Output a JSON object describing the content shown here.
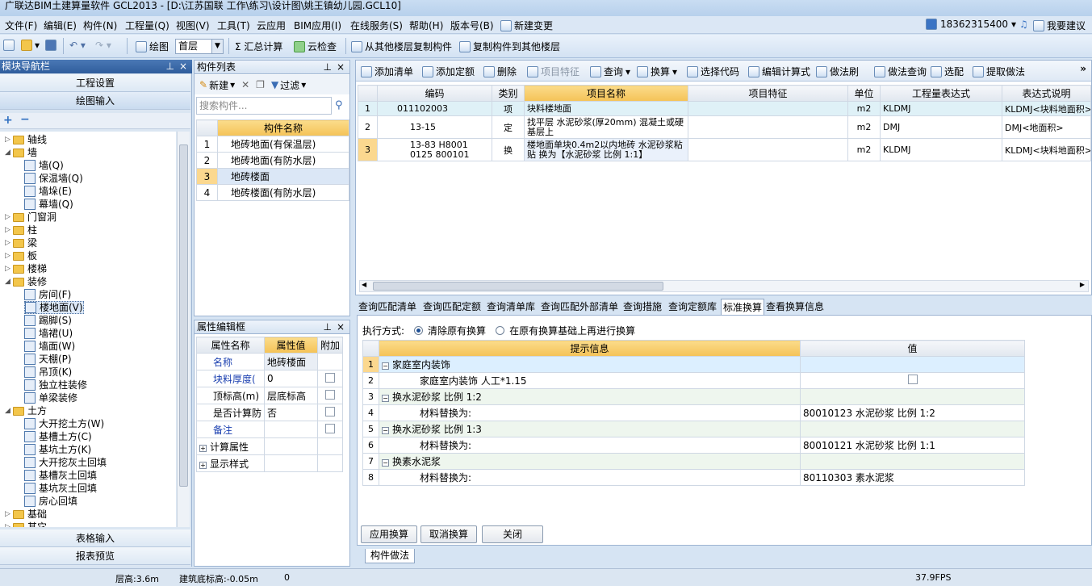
{
  "title": "广联达BIM土建算量软件 GCL2013 - [D:\\江苏国联 工作\\练习\\设计图\\姚王镇幼儿园.GCL10]",
  "menu": [
    "文件(F)",
    "编辑(E)",
    "构件(N)",
    "工程量(Q)",
    "视图(V)",
    "工具(T)",
    "云应用",
    "BIM应用(I)",
    "在线服务(S)",
    "帮助(H)",
    "版本号(B)",
    "新建变更"
  ],
  "account": "18362315400",
  "suggest": "我要建议",
  "toolbar": {
    "draw": "绘图",
    "floor": "首层",
    "sum": "Σ 汇总计算",
    "cloudcheck": "云检查",
    "copy_from": "从其他楼层复制构件",
    "copy_to": "复制构件到其他楼层"
  },
  "nav": {
    "title": "模块导航栏",
    "project_settings": "工程设置",
    "draw_input": "绘图输入",
    "table_input": "表格输入",
    "report_preview": "报表预览",
    "tree": [
      {
        "label": "轴线",
        "level": 0,
        "arrow": "▷"
      },
      {
        "label": "墙",
        "level": 0,
        "arrow": "◢"
      },
      {
        "label": "墙(Q)",
        "level": 1
      },
      {
        "label": "保温墙(Q)",
        "level": 1
      },
      {
        "label": "墙垛(E)",
        "level": 1
      },
      {
        "label": "幕墙(Q)",
        "level": 1
      },
      {
        "label": "门窗洞",
        "level": 0,
        "arrow": "▷"
      },
      {
        "label": "柱",
        "level": 0,
        "arrow": "▷"
      },
      {
        "label": "梁",
        "level": 0,
        "arrow": "▷"
      },
      {
        "label": "板",
        "level": 0,
        "arrow": "▷"
      },
      {
        "label": "楼梯",
        "level": 0,
        "arrow": "▷"
      },
      {
        "label": "装修",
        "level": 0,
        "arrow": "◢"
      },
      {
        "label": "房间(F)",
        "level": 1
      },
      {
        "label": "楼地面(V)",
        "level": 1,
        "selected": true
      },
      {
        "label": "踢脚(S)",
        "level": 1
      },
      {
        "label": "墙裙(U)",
        "level": 1
      },
      {
        "label": "墙面(W)",
        "level": 1
      },
      {
        "label": "天棚(P)",
        "level": 1
      },
      {
        "label": "吊顶(K)",
        "level": 1
      },
      {
        "label": "独立柱装修",
        "level": 1
      },
      {
        "label": "单梁装修",
        "level": 1
      },
      {
        "label": "土方",
        "level": 0,
        "arrow": "◢"
      },
      {
        "label": "大开挖土方(W)",
        "level": 1
      },
      {
        "label": "基槽土方(C)",
        "level": 1
      },
      {
        "label": "基坑土方(K)",
        "level": 1
      },
      {
        "label": "大开挖灰土回填",
        "level": 1
      },
      {
        "label": "基槽灰土回填",
        "level": 1
      },
      {
        "label": "基坑灰土回填",
        "level": 1
      },
      {
        "label": "房心回填",
        "level": 1
      },
      {
        "label": "基础",
        "level": 0,
        "arrow": "▷"
      },
      {
        "label": "其它",
        "level": 0,
        "arrow": "▷"
      }
    ]
  },
  "complist": {
    "title": "构件列表",
    "new": "新建",
    "filter": "过滤",
    "search_placeholder": "搜索构件...",
    "col": "构件名称",
    "rows": [
      {
        "n": "1",
        "name": "地砖地面(有保温层)"
      },
      {
        "n": "2",
        "name": "地砖地面(有防水层)"
      },
      {
        "n": "3",
        "name": "地砖楼面",
        "selected": true
      },
      {
        "n": "4",
        "name": "地砖楼面(有防水层)"
      }
    ]
  },
  "props": {
    "title": "属性编辑框",
    "cols": [
      "属性名称",
      "属性值",
      "附加"
    ],
    "rows": [
      {
        "name": "名称",
        "value": "地砖楼面",
        "blue": true
      },
      {
        "name": "块料厚度(",
        "value": "0",
        "blue": true,
        "chk": true
      },
      {
        "name": "顶标高(m)",
        "value": "层底标高",
        "chk": true
      },
      {
        "name": "是否计算防",
        "value": "否",
        "chk": true
      },
      {
        "name": "备注",
        "value": "",
        "blue": true,
        "chk": true
      },
      {
        "name": "计算属性",
        "value": "",
        "plus": true
      },
      {
        "name": "显示样式",
        "value": "",
        "plus": true
      }
    ]
  },
  "qtool": [
    "添加清单",
    "添加定额",
    "删除",
    "项目特征",
    "查询",
    "换算",
    "选择代码",
    "编辑计算式",
    "做法刷",
    "做法查询",
    "选配",
    "提取做法"
  ],
  "qgrid": {
    "cols": [
      "编码",
      "类别",
      "项目名称",
      "项目特征",
      "单位",
      "工程量表达式",
      "表达式说明"
    ],
    "rows": [
      {
        "n": "1",
        "code": "011102003",
        "type": "项",
        "name": "块料楼地面",
        "feat": "",
        "unit": "m2",
        "expr": "KLDMJ",
        "desc": "KLDMJ<块料地面积>"
      },
      {
        "n": "2",
        "code": "13-15",
        "type": "定",
        "name": "找平层 水泥砂浆(厚20mm) 混凝土或硬基层上",
        "feat": "",
        "unit": "m2",
        "expr": "DMJ",
        "desc": "DMJ<地面积>"
      },
      {
        "n": "3",
        "code": "13-83 H8001 0125 800101",
        "type": "换",
        "name": "楼地面单块0.4m2以内地砖 水泥砂浆粘贴 换为【水泥砂浆 比例 1:1】",
        "feat": "",
        "unit": "m2",
        "expr": "KLDMJ",
        "desc": "KLDMJ<块料地面积>"
      }
    ]
  },
  "querytabs": [
    "查询匹配清单",
    "查询匹配定额",
    "查询清单库",
    "查询匹配外部清单",
    "查询措施",
    "查询定额库",
    "标准换算",
    "查看换算信息"
  ],
  "conv": {
    "mode_label": "执行方式:",
    "opt1": "清除原有换算",
    "opt2": "在原有换算基础上再进行换算",
    "cols": [
      "提示信息",
      "值"
    ],
    "rows": [
      {
        "n": "1",
        "text": "家庭室内装饰",
        "group": true,
        "value": ""
      },
      {
        "n": "2",
        "text": "家庭室内装饰 人工*1.15",
        "value": "",
        "chk": true
      },
      {
        "n": "3",
        "text": "换水泥砂浆 比例 1:2",
        "group": true,
        "value": ""
      },
      {
        "n": "4",
        "text": "材料替换为:",
        "value": "80010123  水泥砂浆 比例 1:2"
      },
      {
        "n": "5",
        "text": "换水泥砂浆 比例 1:3",
        "group": true,
        "value": ""
      },
      {
        "n": "6",
        "text": "材料替换为:",
        "value": "80010121  水泥砂浆 比例 1:1"
      },
      {
        "n": "7",
        "text": "换素水泥浆",
        "group": true,
        "value": ""
      },
      {
        "n": "8",
        "text": "材料替换为:",
        "value": "80110303  素水泥浆"
      }
    ],
    "apply": "应用换算",
    "cancel": "取消换算",
    "close": "关闭"
  },
  "bottom_tab": "构件做法",
  "status": {
    "height": "层高:3.6m",
    "base": "建筑底标高:-0.05m",
    "zero": "0",
    "fps": "37.9FPS"
  }
}
